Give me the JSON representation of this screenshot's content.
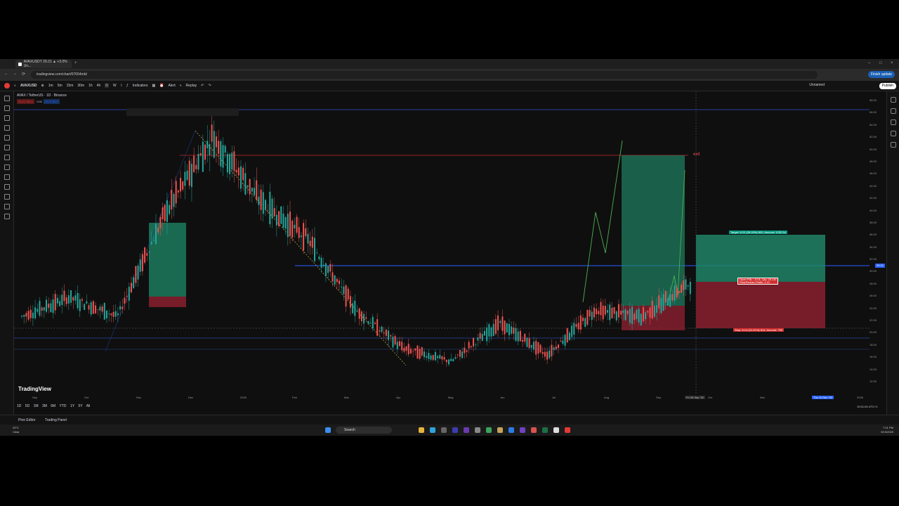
{
  "browser": {
    "tab_title": "AVAXUSDT 29.21 ▲ +3.0% Un...",
    "url": "tradingview.com/chart/07654mb/",
    "update_label": "Finish update"
  },
  "toolbar": {
    "symbol": "AVAXUSD",
    "intervals": [
      "1m",
      "5m",
      "15m",
      "30m",
      "1h",
      "4h",
      "D",
      "W"
    ],
    "indicators_label": "Indicators",
    "alert_label": "Alert",
    "replay_label": "Replay",
    "layout_label": "Unnamed",
    "publish_label": "Publish"
  },
  "legend": {
    "title": "AVAX / TetherUS · 1D · Binance",
    "sell": "29.21",
    "sell_label": "SELL",
    "spread": "0.01",
    "buy": "29.22",
    "buy_label": "BUY"
  },
  "annotations": {
    "exit_label": "exit",
    "target_label": "Target: 8.22 (28.15%) 822, Amount: 1232.34",
    "open_pl_label": "Open P&L: -0.01, Qty: 25.110",
    "risk_reward_label": "Risk/Reward Ratio: 1.21",
    "stop_label": "Stop: 6.14 (21.01%) 614, Amount: 750"
  },
  "time_axis": {
    "labels": [
      "Sep",
      "Oct",
      "Nov",
      "Dec",
      "2025",
      "Feb",
      "Mar",
      "Apr",
      "May",
      "Jun",
      "Jul",
      "Aug",
      "Sep",
      "Oct",
      "Nov",
      "Dec"
    ],
    "crosshair_left": "Fri 26 Sep '25",
    "crosshair_right": "Thu 11 Dec '25",
    "next_year": "2026"
  },
  "price_axis": {
    "labels": [
      "58.00",
      "56.00",
      "54.00",
      "52.00",
      "50.00",
      "48.00",
      "46.00",
      "44.00",
      "42.00",
      "40.00",
      "38.00",
      "36.00",
      "34.00",
      "32.00",
      "30.00",
      "28.00",
      "26.00",
      "24.00",
      "22.00",
      "20.00",
      "18.00",
      "16.00",
      "14.00",
      "12.00"
    ],
    "current": "29.21"
  },
  "ranges": [
    "1D",
    "5D",
    "1M",
    "3M",
    "6M",
    "YTD",
    "1Y",
    "5Y",
    "All"
  ],
  "bottom": {
    "pine_label": "Pine Editor",
    "trading_panel_label": "Trading Panel",
    "time_utc": "19:31:04 UTC+1"
  },
  "taskbar": {
    "search_label": "Search",
    "weather_temp": "29°C",
    "weather_desc": "Clear",
    "clock_time": "7:31 PM",
    "clock_date": "9/19/2025"
  },
  "brand": "TradingView",
  "chart_data": {
    "type": "candlestick",
    "symbol": "AVAX / TetherUS",
    "interval": "1D",
    "exchange": "Binance",
    "ylim": [
      12,
      58
    ],
    "closes_approx": [
      {
        "x": "Sep 2024",
        "y": 24
      },
      {
        "x": "Oct 2024",
        "y": 27
      },
      {
        "x": "Nov 2024",
        "y": 24
      },
      {
        "x": "Nov 2024 late",
        "y": 40
      },
      {
        "x": "Dec 2024",
        "y": 52
      },
      {
        "x": "Dec 2024 mid",
        "y": 42
      },
      {
        "x": "Jan 2025",
        "y": 36
      },
      {
        "x": "Feb 2025",
        "y": 25
      },
      {
        "x": "Mar 2025",
        "y": 19
      },
      {
        "x": "Apr 2025",
        "y": 17
      },
      {
        "x": "May 2025",
        "y": 23
      },
      {
        "x": "Jun 2025",
        "y": 18
      },
      {
        "x": "Jul 2025",
        "y": 25
      },
      {
        "x": "Aug 2025",
        "y": 24
      },
      {
        "x": "Sep 2025",
        "y": 29.21
      }
    ]
  }
}
